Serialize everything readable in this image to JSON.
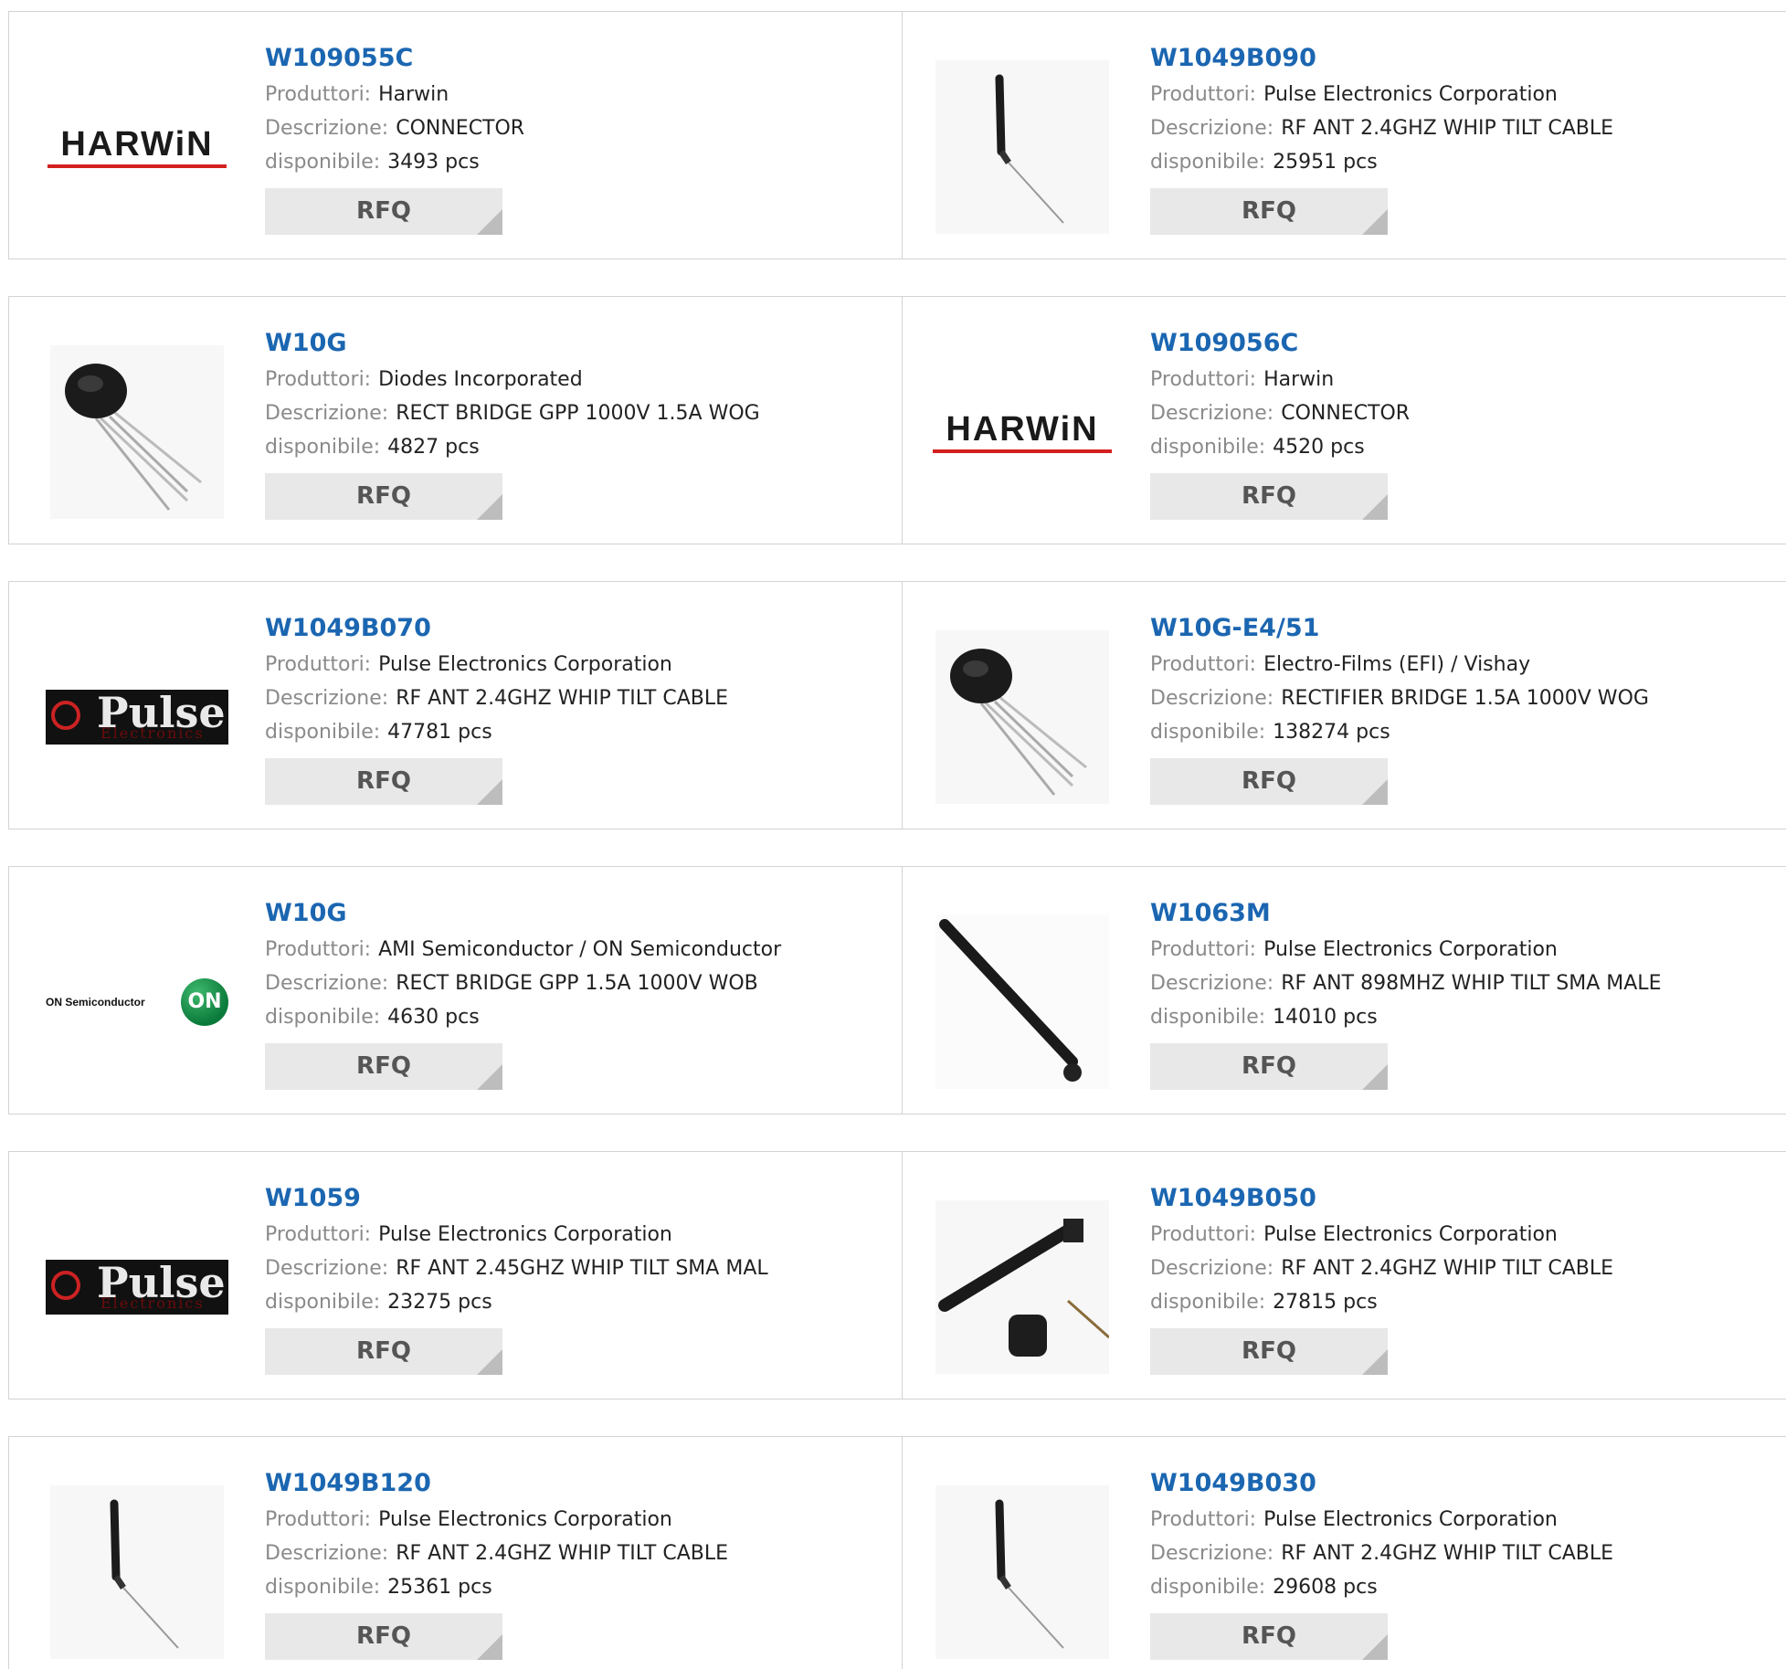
{
  "labels": {
    "manufacturer": "Produttori:",
    "description": "Descrizione:",
    "available": "disponibile:",
    "rfq": "RFQ"
  },
  "products": [
    {
      "part": "W109055C",
      "manufacturer": "Harwin",
      "description": "CONNECTOR",
      "stock": "3493 pcs",
      "image": "harwin-logo"
    },
    {
      "part": "W1049B090",
      "manufacturer": "Pulse Electronics Corporation",
      "description": "RF ANT 2.4GHZ WHIP TILT CABLE",
      "stock": "25951 pcs",
      "image": "whip-antenna-cable-photo"
    },
    {
      "part": "W10G",
      "manufacturer": "Diodes Incorporated",
      "description": "RECT BRIDGE GPP 1000V 1.5A WOG",
      "stock": "4827 pcs",
      "image": "bridge-rectifier-photo"
    },
    {
      "part": "W109056C",
      "manufacturer": "Harwin",
      "description": "CONNECTOR",
      "stock": "4520 pcs",
      "image": "harwin-logo"
    },
    {
      "part": "W1049B070",
      "manufacturer": "Pulse Electronics Corporation",
      "description": "RF ANT 2.4GHZ WHIP TILT CABLE",
      "stock": "47781 pcs",
      "image": "pulse-electronics-logo"
    },
    {
      "part": "W10G-E4/51",
      "manufacturer": "Electro-Films (EFI) / Vishay",
      "description": "RECTIFIER BRIDGE 1.5A 1000V WOG",
      "stock": "138274 pcs",
      "image": "bridge-rectifier-photo"
    },
    {
      "part": "W10G",
      "manufacturer": "AMI Semiconductor / ON Semiconductor",
      "description": "RECT BRIDGE GPP 1.5A 1000V WOB",
      "stock": "4630 pcs",
      "image": "on-semiconductor-logo"
    },
    {
      "part": "W1063M",
      "manufacturer": "Pulse Electronics Corporation",
      "description": "RF ANT 898MHZ WHIP TILT SMA MALE",
      "stock": "14010 pcs",
      "image": "sma-antenna-photo"
    },
    {
      "part": "W1059",
      "manufacturer": "Pulse Electronics Corporation",
      "description": "RF ANT 2.45GHZ WHIP TILT SMA MAL",
      "stock": "23275 pcs",
      "image": "pulse-electronics-logo"
    },
    {
      "part": "W1049B050",
      "manufacturer": "Pulse Electronics Corporation",
      "description": "RF ANT 2.4GHZ WHIP TILT CABLE",
      "stock": "27815 pcs",
      "image": "antenna-kit-photo"
    },
    {
      "part": "W1049B120",
      "manufacturer": "Pulse Electronics Corporation",
      "description": "RF ANT 2.4GHZ WHIP TILT CABLE",
      "stock": "25361 pcs",
      "image": "whip-antenna-cable-photo"
    },
    {
      "part": "W1049B030",
      "manufacturer": "Pulse Electronics Corporation",
      "description": "RF ANT 2.4GHZ WHIP TILT CABLE",
      "stock": "29608 pcs",
      "image": "whip-antenna-cable-photo"
    }
  ],
  "logos": {
    "harwin": "HARWiN",
    "pulse_word": "Pulse",
    "pulse_sub": "Electronics",
    "on_text": "ON Semiconductor",
    "on_mark": "ON"
  },
  "colors": {
    "part_link": "#1b66b1",
    "label": "#8a8a8a",
    "rfq_bg": "#e8e8e8",
    "border": "#d3d3d3",
    "harwin_red": "#d3211e",
    "on_green": "#0a7a3a"
  }
}
